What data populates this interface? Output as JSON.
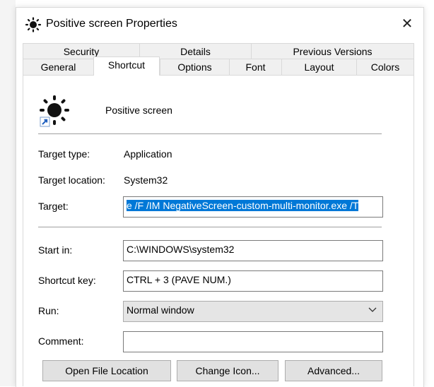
{
  "window": {
    "title": "Positive screen Properties",
    "close_glyph": "✕"
  },
  "tabs": {
    "row1": [
      "Security",
      "Details",
      "Previous Versions"
    ],
    "row2": [
      "General",
      "Shortcut",
      "Options",
      "Font",
      "Layout",
      "Colors"
    ],
    "active": "Shortcut"
  },
  "shortcut": {
    "name": "Positive screen",
    "target_type_label": "Target type:",
    "target_type": "Application",
    "target_location_label": "Target location:",
    "target_location": "System32",
    "target_label": "Target:",
    "target_value": "e /F /IM NegativeScreen-custom-multi-monitor.exe /T",
    "start_in_label": "Start in:",
    "start_in": "C:\\WINDOWS\\system32",
    "shortcut_key_label": "Shortcut key:",
    "shortcut_key": "CTRL + 3 (PAVE NUM.)",
    "run_label": "Run:",
    "run_value": "Normal window",
    "comment_label": "Comment:",
    "comment_value": ""
  },
  "buttons": {
    "open_file_location": "Open File Location",
    "change_icon": "Change Icon...",
    "advanced": "Advanced..."
  },
  "icons": {
    "title": "sun-icon",
    "shortcut": "sun-shortcut-icon",
    "run_dropdown": "chevron-down-icon"
  },
  "colors": {
    "selection": "#0078d7",
    "button_bg": "#e1e1e1",
    "border": "#7a7a7a"
  }
}
